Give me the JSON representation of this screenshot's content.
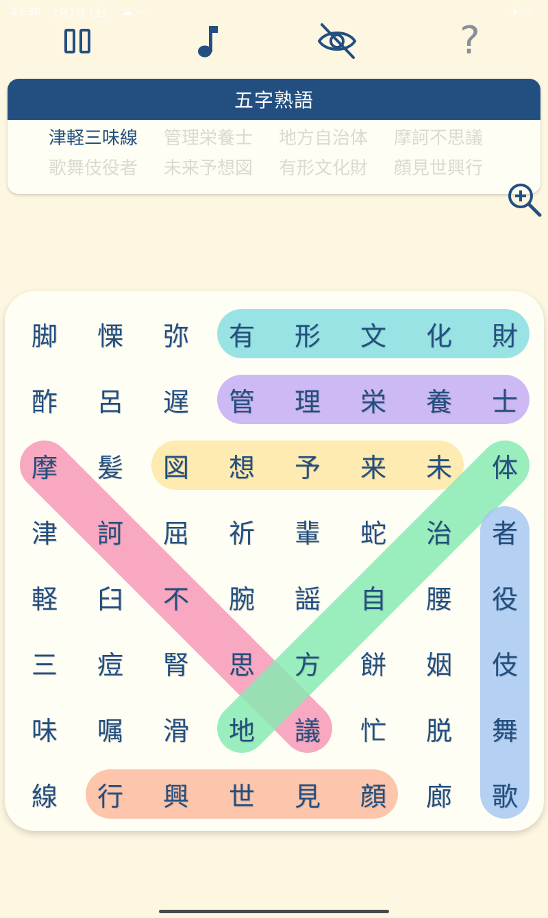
{
  "status_bar": {
    "time": "23:38",
    "date": "2月7日 (土)",
    "notification_icons": "☁ ···",
    "right_icons": "✈ ▭"
  },
  "toolbar": {
    "pause_icon": "pause-icon",
    "music_icon": "music-note-icon",
    "hide_icon": "eye-off-icon",
    "help_label": "?"
  },
  "panel": {
    "title": "五字熟語",
    "words": [
      {
        "text": "津軽三味線",
        "found": false
      },
      {
        "text": "管理栄養士",
        "found": true
      },
      {
        "text": "地方自治体",
        "found": true
      },
      {
        "text": "摩訶不思議",
        "found": true
      },
      {
        "text": "歌舞伎役者",
        "found": true
      },
      {
        "text": "未来予想図",
        "found": true
      },
      {
        "text": "有形文化財",
        "found": true
      },
      {
        "text": "顔見世興行",
        "found": true
      }
    ]
  },
  "grid": {
    "rows": [
      [
        "脚",
        "慄",
        "弥",
        "有",
        "形",
        "文",
        "化",
        "財"
      ],
      [
        "酢",
        "呂",
        "遅",
        "管",
        "理",
        "栄",
        "養",
        "士"
      ],
      [
        "摩",
        "髪",
        "図",
        "想",
        "予",
        "来",
        "未",
        "体"
      ],
      [
        "津",
        "訶",
        "屈",
        "祈",
        "輩",
        "蛇",
        "治",
        "者"
      ],
      [
        "軽",
        "臼",
        "不",
        "腕",
        "謡",
        "自",
        "腰",
        "役"
      ],
      [
        "三",
        "痘",
        "腎",
        "思",
        "方",
        "餅",
        "姻",
        "伎"
      ],
      [
        "味",
        "嘱",
        "滑",
        "地",
        "議",
        "忙",
        "脱",
        "舞"
      ],
      [
        "線",
        "行",
        "興",
        "世",
        "見",
        "顔",
        "廊",
        "歌"
      ]
    ]
  },
  "found_highlights": [
    {
      "word": "有形文化財",
      "color": "#83dde0",
      "from": [
        0,
        3
      ],
      "to": [
        0,
        7
      ]
    },
    {
      "word": "管理栄養士",
      "color": "#c2aaf3",
      "from": [
        1,
        3
      ],
      "to": [
        1,
        7
      ]
    },
    {
      "word": "未来予想図",
      "color": "#fde7a3",
      "from": [
        2,
        6
      ],
      "to": [
        2,
        2
      ]
    },
    {
      "word": "摩訶不思議",
      "color": "#f795b5",
      "from": [
        2,
        0
      ],
      "to": [
        6,
        4
      ]
    },
    {
      "word": "地方自治体",
      "color": "#84eab1",
      "from": [
        6,
        3
      ],
      "to": [
        2,
        7
      ]
    },
    {
      "word": "歌舞伎役者",
      "color": "#a3c6f3",
      "from": [
        7,
        7
      ],
      "to": [
        3,
        7
      ]
    },
    {
      "word": "顔見世興行",
      "color": "#fdb89b",
      "from": [
        7,
        5
      ],
      "to": [
        7,
        1
      ]
    }
  ]
}
